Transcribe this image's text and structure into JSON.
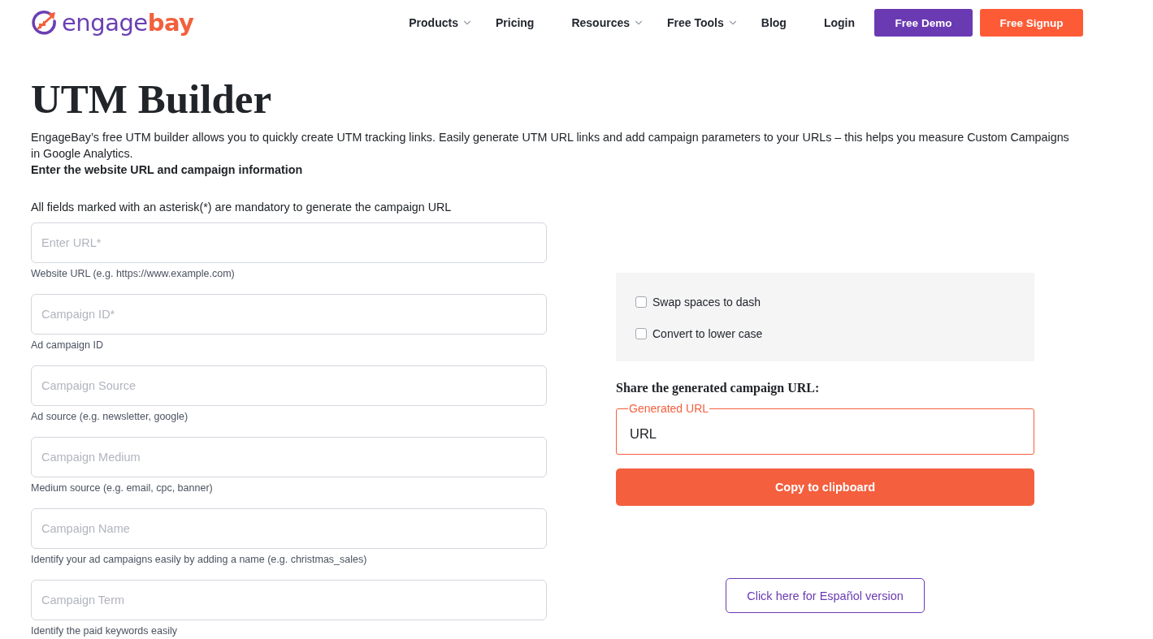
{
  "header": {
    "logo": {
      "text": "engage",
      "accent": "bay"
    },
    "nav": [
      {
        "label": "Products",
        "dropdown": true
      },
      {
        "label": "Pricing",
        "dropdown": false
      },
      {
        "label": "Resources",
        "dropdown": true
      },
      {
        "label": "Free Tools",
        "dropdown": true
      },
      {
        "label": "Blog",
        "dropdown": false
      }
    ],
    "login": "Login",
    "buttons": [
      {
        "label": "Free Demo",
        "kind": "primary"
      },
      {
        "label": "Free Signup",
        "kind": "accent"
      }
    ]
  },
  "page": {
    "title": "UTM Builder",
    "description": "EngageBay’s free UTM builder allows you to quickly create UTM tracking links. Easily generate UTM URL links and add campaign parameters to your URLs – this helps you measure Custom Campaigns in Google Analytics.",
    "subheading": "Enter the website URL and campaign information",
    "mandatory_note": "All fields marked with an asterisk(*) are mandatory to generate the campaign URL"
  },
  "form": {
    "fields": [
      {
        "placeholder": "Enter URL*",
        "hint": "Website URL (e.g. https://www.example.com)"
      },
      {
        "placeholder": "Campaign ID*",
        "hint": "Ad campaign ID"
      },
      {
        "placeholder": "Campaign Source",
        "hint": "Ad source (e.g. newsletter, google)"
      },
      {
        "placeholder": "Campaign Medium",
        "hint": "Medium source (e.g. email, cpc, banner)"
      },
      {
        "placeholder": "Campaign Name",
        "hint": "Identify your ad campaigns easily by adding a name (e.g. christmas_sales)"
      },
      {
        "placeholder": "Campaign Term",
        "hint": "Identify the paid keywords easily"
      }
    ]
  },
  "options": [
    {
      "label": "Swap spaces to dash",
      "checked": false
    },
    {
      "label": "Convert to lower case",
      "checked": false
    }
  ],
  "share": {
    "heading": "Share the generated campaign URL:",
    "output": {
      "label": "Generated URL",
      "value": "URL"
    },
    "copy_button": "Copy to clipboard"
  },
  "language_link": "Click here for Español version"
}
